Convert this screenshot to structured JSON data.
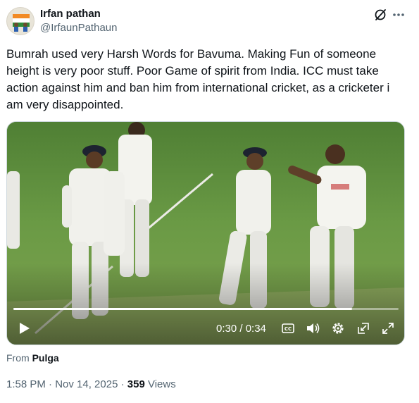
{
  "author": {
    "name": "Irfan pathan",
    "handle": "@IrfaunPathaun"
  },
  "tweet": {
    "text": "Bumrah used very Harsh Words for Bavuma. Making Fun of someone height is very poor stuff. Poor Game of spirit from India. ICC must take action against him and ban him from international cricket, as a cricketer i am very disappointed."
  },
  "video": {
    "time_display": "0:30 / 0:34",
    "progress": 0.88
  },
  "source": {
    "prefix": "From",
    "name": "Pulga"
  },
  "meta": {
    "timestamp": "1:58 PM · Nov 14, 2025 · ",
    "views_count": "359",
    "views_label": " Views"
  },
  "icons": {
    "grok": "grok-icon",
    "more": "more-icon",
    "play": "play-icon",
    "captions": "captions-icon",
    "volume": "volume-icon",
    "settings": "settings-icon",
    "pip": "pip-icon",
    "fullscreen": "fullscreen-icon"
  }
}
